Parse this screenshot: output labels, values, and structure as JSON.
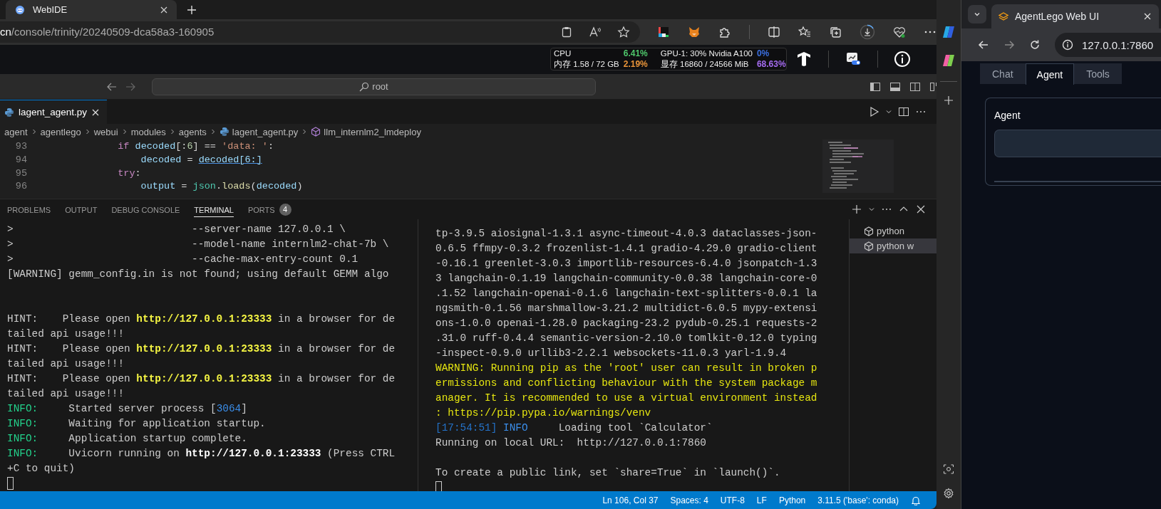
{
  "left_browser": {
    "tab": {
      "title": "WebIDE",
      "selected": true
    },
    "address": {
      "host": "cn",
      "path": "/console/trinity/20240509-dca58a3-160905"
    }
  },
  "ide_header": {
    "stats": [
      {
        "label": "CPU",
        "percent": "6.41%",
        "color": "#4ec66b"
      },
      {
        "label": "GPU-1: 30% Nvidia A100",
        "percent": "0%",
        "color": "#3b6fe0"
      },
      {
        "label": "内存 1.58 / 72 GB",
        "percent": "2.19%",
        "color": "#e8943a"
      },
      {
        "label": "显存 16860 / 24566 MiB",
        "percent": "68.63%",
        "color": "#a56cf0"
      }
    ]
  },
  "command_center": {
    "value": "root"
  },
  "editor": {
    "tabs": [
      {
        "label": "lagent_agent.py",
        "selected": true
      }
    ],
    "breadcrumbs": [
      {
        "label": "agent",
        "kind": "folder"
      },
      {
        "label": "agentlego",
        "kind": "folder"
      },
      {
        "label": "webui",
        "kind": "folder"
      },
      {
        "label": "modules",
        "kind": "folder"
      },
      {
        "label": "agents",
        "kind": "folder"
      },
      {
        "label": "lagent_agent.py",
        "kind": "file"
      },
      {
        "label": "llm_internlm2_lmdeploy",
        "kind": "symbol"
      }
    ],
    "lines": [
      {
        "number": "93",
        "parts": [
          {
            "text": "            if ",
            "kind": "keyword"
          },
          {
            "text": "decoded",
            "kind": "variable"
          },
          {
            "text": "[:",
            "kind": "plain"
          },
          {
            "text": "6",
            "kind": "number"
          },
          {
            "text": "] == ",
            "kind": "plain"
          },
          {
            "text": "'data: '",
            "kind": "string"
          },
          {
            "text": ":",
            "kind": "plain"
          }
        ]
      },
      {
        "number": "94",
        "parts": [
          {
            "text": "                decoded",
            "kind": "variable"
          },
          {
            "text": " = ",
            "kind": "plain"
          },
          {
            "text": "decoded[6:]",
            "kind": "link"
          }
        ]
      },
      {
        "number": "95",
        "parts": [
          {
            "text": "            try",
            "kind": "keyword"
          },
          {
            "text": ":",
            "kind": "plain"
          }
        ]
      },
      {
        "number": "96",
        "parts": [
          {
            "text": "                output",
            "kind": "variable"
          },
          {
            "text": " = ",
            "kind": "plain"
          },
          {
            "text": "json",
            "kind": "class"
          },
          {
            "text": ".",
            "kind": "plain"
          },
          {
            "text": "loads",
            "kind": "function"
          },
          {
            "text": "(",
            "kind": "plain"
          },
          {
            "text": "decoded",
            "kind": "variable"
          },
          {
            "text": ")",
            "kind": "plain"
          }
        ]
      }
    ]
  },
  "panel": {
    "tabs": [
      {
        "label": "PROBLEMS",
        "selected": false
      },
      {
        "label": "OUTPUT",
        "selected": false
      },
      {
        "label": "DEBUG CONSOLE",
        "selected": false
      },
      {
        "label": "TERMINAL",
        "selected": true
      },
      {
        "label": "PORTS",
        "selected": false,
        "badge": "4"
      }
    ],
    "terminal_left": {
      "lines": [
        {
          "kind": "text",
          "parts": [
            {
              "text": ">                             --server-name 127.0.0.1 \\",
              "kind": "plain"
            }
          ]
        },
        {
          "kind": "text",
          "parts": [
            {
              "text": ">                             --model-name internlm2-chat-7b \\",
              "kind": "plain"
            }
          ]
        },
        {
          "kind": "text",
          "parts": [
            {
              "text": ">                             --cache-max-entry-count 0.1",
              "kind": "plain"
            }
          ]
        },
        {
          "kind": "text",
          "parts": [
            {
              "text": "[WARNING] gemm_config.in is not found; using default GEMM algo",
              "kind": "plain"
            }
          ]
        },
        {
          "kind": "blank"
        },
        {
          "kind": "blank"
        },
        {
          "kind": "text",
          "parts": [
            {
              "text": "HINT:    Please open ",
              "kind": "plain"
            },
            {
              "text": "http://127.0.0.1:23333",
              "kind": "url"
            },
            {
              "text": " in a browser for de",
              "kind": "plain"
            }
          ]
        },
        {
          "kind": "text",
          "parts": [
            {
              "text": "tailed api usage!!!",
              "kind": "plain"
            }
          ]
        },
        {
          "kind": "text",
          "parts": [
            {
              "text": "HINT:    Please open ",
              "kind": "plain"
            },
            {
              "text": "http://127.0.0.1:23333",
              "kind": "url"
            },
            {
              "text": " in a browser for de",
              "kind": "plain"
            }
          ]
        },
        {
          "kind": "text",
          "parts": [
            {
              "text": "tailed api usage!!!",
              "kind": "plain"
            }
          ]
        },
        {
          "kind": "text",
          "parts": [
            {
              "text": "HINT:    Please open ",
              "kind": "plain"
            },
            {
              "text": "http://127.0.0.1:23333",
              "kind": "url"
            },
            {
              "text": " in a browser for de",
              "kind": "plain"
            }
          ]
        },
        {
          "kind": "text",
          "parts": [
            {
              "text": "tailed api usage!!!",
              "kind": "plain"
            }
          ]
        },
        {
          "kind": "text",
          "parts": [
            {
              "text": "INFO:",
              "kind": "info"
            },
            {
              "text": "     Started server process [",
              "kind": "plain"
            },
            {
              "text": "3064",
              "kind": "pid"
            },
            {
              "text": "]",
              "kind": "plain"
            }
          ]
        },
        {
          "kind": "text",
          "parts": [
            {
              "text": "INFO:",
              "kind": "info"
            },
            {
              "text": "     Waiting for application startup.",
              "kind": "plain"
            }
          ]
        },
        {
          "kind": "text",
          "parts": [
            {
              "text": "INFO:",
              "kind": "info"
            },
            {
              "text": "     Application startup complete.",
              "kind": "plain"
            }
          ]
        },
        {
          "kind": "text",
          "parts": [
            {
              "text": "INFO:",
              "kind": "info"
            },
            {
              "text": "     Uvicorn running on ",
              "kind": "plain"
            },
            {
              "text": "http://127.0.0.1:23333",
              "kind": "bold"
            },
            {
              "text": " (Press CTRL",
              "kind": "plain"
            }
          ]
        },
        {
          "kind": "text",
          "parts": [
            {
              "text": "+C to quit)",
              "kind": "plain"
            }
          ]
        },
        {
          "kind": "cursor"
        }
      ]
    },
    "terminal_right": {
      "lines": [
        {
          "kind": "text",
          "parts": [
            {
              "text": "tp-3.9.5 aiosignal-1.3.1 async-timeout-4.0.3 dataclasses-json-",
              "kind": "plain"
            }
          ]
        },
        {
          "kind": "text",
          "parts": [
            {
              "text": "0.6.5 ffmpy-0.3.2 frozenlist-1.4.1 gradio-4.29.0 gradio-client",
              "kind": "plain"
            }
          ]
        },
        {
          "kind": "text",
          "parts": [
            {
              "text": "-0.16.1 greenlet-3.0.3 importlib-resources-6.4.0 jsonpatch-1.3",
              "kind": "plain"
            }
          ]
        },
        {
          "kind": "text",
          "parts": [
            {
              "text": "3 langchain-0.1.19 langchain-community-0.0.38 langchain-core-0",
              "kind": "plain"
            }
          ]
        },
        {
          "kind": "text",
          "parts": [
            {
              "text": ".1.52 langchain-openai-0.1.6 langchain-text-splitters-0.0.1 la",
              "kind": "plain"
            }
          ]
        },
        {
          "kind": "text",
          "parts": [
            {
              "text": "ngsmith-0.1.56 marshmallow-3.21.2 multidict-6.0.5 mypy-extensi",
              "kind": "plain"
            }
          ]
        },
        {
          "kind": "text",
          "parts": [
            {
              "text": "ons-1.0.0 openai-1.28.0 packaging-23.2 pydub-0.25.1 requests-2",
              "kind": "plain"
            }
          ]
        },
        {
          "kind": "text",
          "parts": [
            {
              "text": ".31.0 ruff-0.4.4 semantic-version-2.10.0 tomlkit-0.12.0 typing",
              "kind": "plain"
            }
          ]
        },
        {
          "kind": "text",
          "parts": [
            {
              "text": "-inspect-0.9.0 urllib3-2.2.1 websockets-11.0.3 yarl-1.9.4",
              "kind": "plain"
            }
          ]
        },
        {
          "kind": "text",
          "parts": [
            {
              "text": "WARNING: Running pip as the 'root' user can result in broken p",
              "kind": "warn"
            }
          ]
        },
        {
          "kind": "text",
          "parts": [
            {
              "text": "ermissions and conflicting behaviour with the system package m",
              "kind": "warn"
            }
          ]
        },
        {
          "kind": "text",
          "parts": [
            {
              "text": "anager. It is recommended to use a virtual environment instead",
              "kind": "warn"
            }
          ]
        },
        {
          "kind": "text",
          "parts": [
            {
              "text": ": https://pip.pypa.io/warnings/venv",
              "kind": "warn"
            }
          ]
        },
        {
          "kind": "text",
          "parts": [
            {
              "text": "[17:54:51]",
              "kind": "time"
            },
            {
              "text": " INFO",
              "kind": "level"
            },
            {
              "text": "     Loading tool `Calculator`",
              "kind": "plain"
            }
          ]
        },
        {
          "kind": "text",
          "parts": [
            {
              "text": "Running on local URL:  http://127.0.0.1:7860",
              "kind": "plain"
            }
          ]
        },
        {
          "kind": "blank"
        },
        {
          "kind": "text",
          "parts": [
            {
              "text": "To create a public link, set `share=True` in `launch()`.",
              "kind": "plain"
            }
          ]
        },
        {
          "kind": "cursor"
        }
      ]
    },
    "sessions": [
      {
        "label": "python",
        "selected": false
      },
      {
        "label": "python w",
        "selected": true
      }
    ]
  },
  "status_bar": [
    "Ln 106, Col 37",
    "Spaces: 4",
    "UTF-8",
    "LF",
    "Python",
    "3.11.5 ('base': conda)"
  ],
  "right_browser": {
    "tab": {
      "title": "AgentLego Web UI",
      "selected": true
    },
    "address": "127.0.0.1:7860",
    "app": {
      "tabs": [
        {
          "label": "Chat",
          "selected": false
        },
        {
          "label": "Agent",
          "selected": true
        },
        {
          "label": "Tools",
          "selected": false
        }
      ],
      "field_label": "Agent"
    }
  }
}
